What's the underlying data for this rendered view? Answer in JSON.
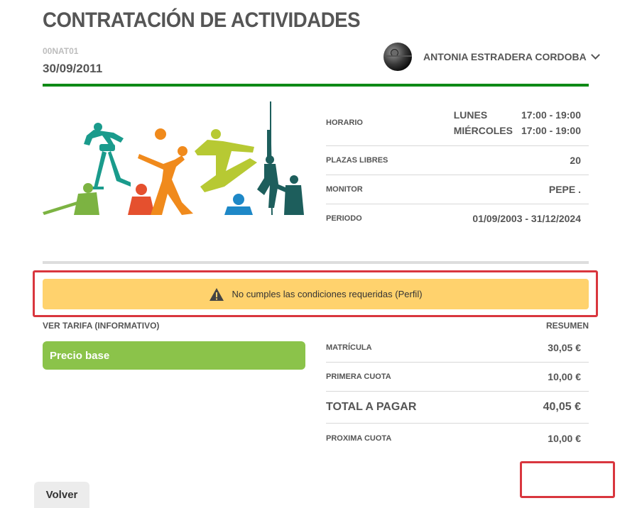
{
  "header": {
    "title": "CONTRATACIÓN DE ACTIVIDADES",
    "code": "00NAT01",
    "date": "30/09/2011"
  },
  "user": {
    "name": "ANTONIA ESTRADERA CORDOBA",
    "avatar_icon": "avatar-image",
    "dropdown_icon": "chevron-down-icon"
  },
  "colors": {
    "accent_green": "#0e8a16",
    "price_green": "#8bc34a",
    "alert_yellow": "#ffd26d",
    "highlight_red": "#d9363e"
  },
  "activity": {
    "schedule_label": "HORARIO",
    "schedule": [
      {
        "day": "LUNES",
        "time": "17:00 - 19:00"
      },
      {
        "day": "MIÉRCOLES",
        "time": "17:00 - 19:00"
      }
    ],
    "places_label": "PLAZAS LIBRES",
    "places_value": "20",
    "monitor_label": "MONITOR",
    "monitor_value": "PEPE .",
    "period_label": "PERIODO",
    "period_value": "01/09/2003 - 31/12/2024"
  },
  "alert": {
    "icon": "warning-icon",
    "message": "No cumples las condiciones requeridas (Perfil)"
  },
  "tariff": {
    "label": "VER TARIFA (INFORMATIVO)",
    "price_base": "Precio base"
  },
  "summary": {
    "label": "RESUMEN",
    "rows": [
      {
        "label": "MATRÍCULA",
        "value": "30,05 €"
      },
      {
        "label": "PRIMERA CUOTA",
        "value": "10,00 €"
      },
      {
        "label": "TOTAL A PAGAR",
        "value": "40,05 €"
      },
      {
        "label": "PROXIMA CUOTA",
        "value": "10,00 €"
      }
    ]
  },
  "actions": {
    "back_label": "Volver"
  }
}
